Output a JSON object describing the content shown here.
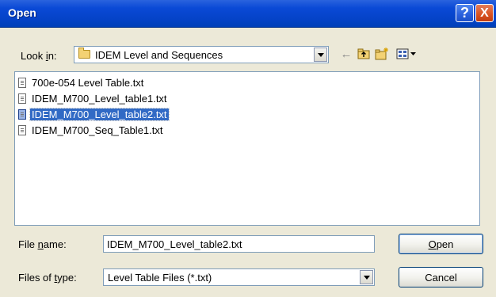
{
  "window": {
    "title": "Open",
    "help_glyph": "?",
    "close_glyph": "X"
  },
  "lookin": {
    "label_pre": "Look ",
    "label_accel": "i",
    "label_post": "n:",
    "value": "IDEM Level and Sequences"
  },
  "toolbar": {
    "back_icon": "←",
    "up_icon": "up-folder-icon",
    "new_folder_icon": "new-folder-icon",
    "view_menu_icon": "view-menu-icon"
  },
  "files": [
    {
      "name": "700e-054  Level Table.txt",
      "selected": false
    },
    {
      "name": "IDEM_M700_Level_table1.txt",
      "selected": false
    },
    {
      "name": "IDEM_M700_Level_table2.txt",
      "selected": true
    },
    {
      "name": "IDEM_M700_Seq_Table1.txt",
      "selected": false
    }
  ],
  "filename": {
    "label_pre": "File ",
    "label_accel": "n",
    "label_post": "ame:",
    "value": "IDEM_M700_Level_table2.txt"
  },
  "filetype": {
    "label_pre": "Files of ",
    "label_accel": "t",
    "label_post": "ype:",
    "value": "Level Table Files (*.txt)"
  },
  "buttons": {
    "open_accel": "O",
    "open_rest": "pen",
    "cancel": "Cancel"
  }
}
